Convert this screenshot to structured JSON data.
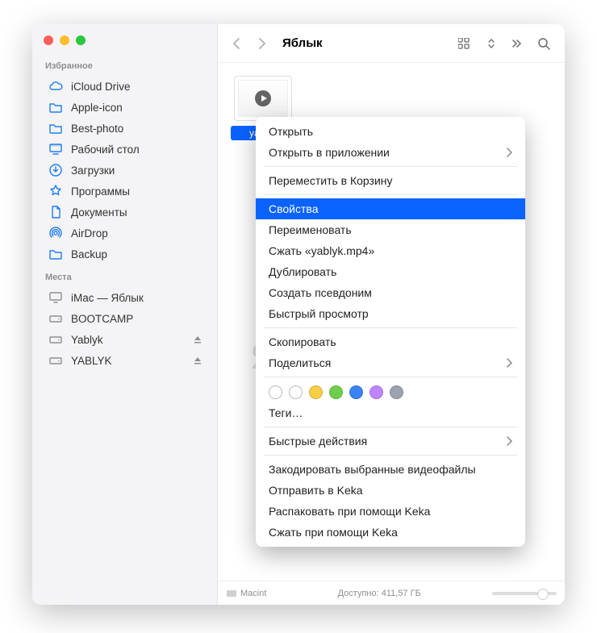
{
  "sidebar": {
    "favorites_label": "Избранное",
    "locations_label": "Места",
    "favorites": [
      {
        "label": "iCloud Drive",
        "icon": "cloud"
      },
      {
        "label": "Apple-icon",
        "icon": "folder"
      },
      {
        "label": "Best-photo",
        "icon": "folder"
      },
      {
        "label": "Рабочий стол",
        "icon": "desktop"
      },
      {
        "label": "Загрузки",
        "icon": "download"
      },
      {
        "label": "Программы",
        "icon": "apps"
      },
      {
        "label": "Документы",
        "icon": "doc"
      },
      {
        "label": "AirDrop",
        "icon": "airdrop"
      },
      {
        "label": "Backup",
        "icon": "folder"
      }
    ],
    "locations": [
      {
        "label": "iMac — Яблык",
        "icon": "display",
        "eject": false
      },
      {
        "label": "BOOTCAMP",
        "icon": "disk",
        "eject": false
      },
      {
        "label": "Yablyk",
        "icon": "disk",
        "eject": true
      },
      {
        "label": "YABLYK",
        "icon": "disk",
        "eject": true
      }
    ]
  },
  "toolbar": {
    "title": "Яблык"
  },
  "file": {
    "label": "yablyk.mp4",
    "label_short": "yablyk"
  },
  "watermark": "Яблык",
  "context_menu": [
    {
      "type": "item",
      "label": "Открыть"
    },
    {
      "type": "item",
      "label": "Открыть в приложении",
      "submenu": true
    },
    {
      "type": "sep"
    },
    {
      "type": "item",
      "label": "Переместить в Корзину"
    },
    {
      "type": "sep"
    },
    {
      "type": "item",
      "label": "Свойства",
      "selected": true
    },
    {
      "type": "item",
      "label": "Переименовать"
    },
    {
      "type": "item",
      "label": "Сжать «yablyk.mp4»"
    },
    {
      "type": "item",
      "label": "Дублировать"
    },
    {
      "type": "item",
      "label": "Создать псевдоним"
    },
    {
      "type": "item",
      "label": "Быстрый просмотр"
    },
    {
      "type": "sep"
    },
    {
      "type": "item",
      "label": "Скопировать"
    },
    {
      "type": "item",
      "label": "Поделиться",
      "submenu": true
    },
    {
      "type": "sep"
    },
    {
      "type": "tags"
    },
    {
      "type": "item",
      "label": "Теги…"
    },
    {
      "type": "sep"
    },
    {
      "type": "item",
      "label": "Быстрые действия",
      "submenu": true
    },
    {
      "type": "sep"
    },
    {
      "type": "item",
      "label": "Закодировать выбранные видеофайлы"
    },
    {
      "type": "item",
      "label": "Отправить в Keka"
    },
    {
      "type": "item",
      "label": "Распаковать при помощи Keka"
    },
    {
      "type": "item",
      "label": "Сжать при помощи Keka"
    }
  ],
  "tag_colors": [
    "#ffffff",
    "#ffffff",
    "#f7ce46",
    "#6fcf4d",
    "#3b82f6",
    "#c084fc",
    "#9ca3af"
  ],
  "status": {
    "path_item": "Macint",
    "available": "Доступно: 411,57 ГБ"
  }
}
